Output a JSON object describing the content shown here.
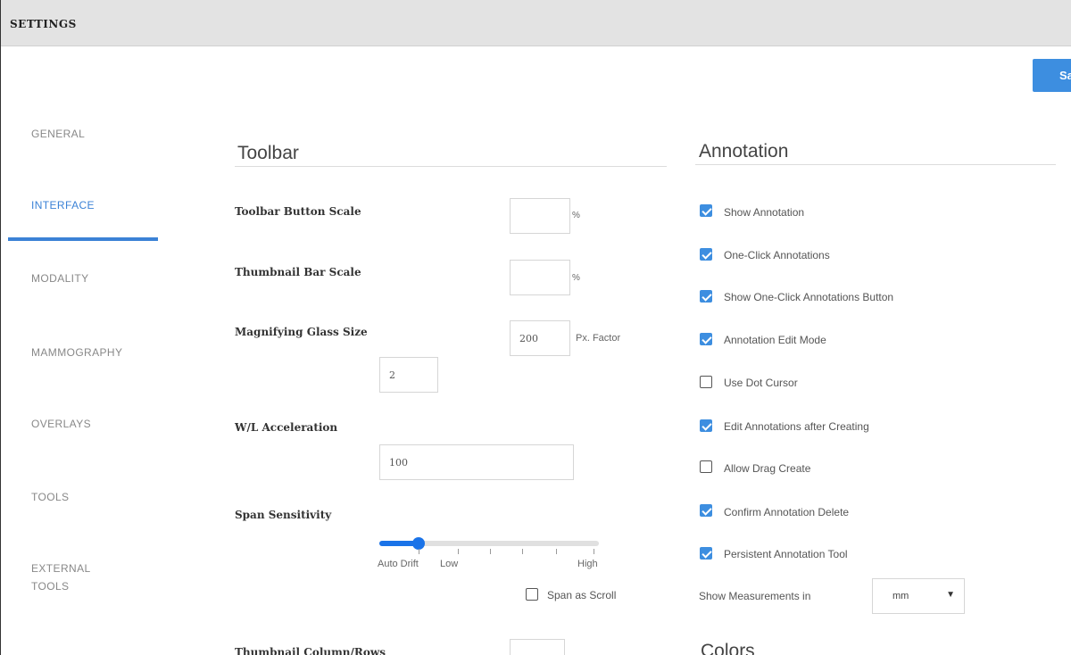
{
  "window": {
    "title": "SETTINGS"
  },
  "toolbar": {
    "save_label": "Sa"
  },
  "sidebar": {
    "items": [
      {
        "label": "GENERAL"
      },
      {
        "label": "INTERFACE",
        "active": true
      },
      {
        "label": "MODALITY"
      },
      {
        "label": "MAMMOGRAPHY"
      },
      {
        "label": "OVERLAYS"
      },
      {
        "label": "TOOLS"
      },
      {
        "label": "EXTERNAL"
      },
      {
        "label": "TOOLS"
      }
    ]
  },
  "toolbar_section": {
    "title": "Toolbar",
    "button_scale": {
      "label": "Toolbar Button Scale",
      "value": "",
      "unit": "%"
    },
    "thumbnail_scale": {
      "label": "Thumbnail Bar Scale",
      "value": "",
      "unit": "%"
    },
    "magnifier": {
      "label": "Magnifying Glass Size",
      "value": "200",
      "unit_label": "Px. Factor",
      "factor": "2"
    },
    "wl_acceleration": {
      "label": "W/L Acceleration",
      "value": "100"
    },
    "span_sensitivity": {
      "label": "Span Sensitivity",
      "level": 0.18,
      "captions": {
        "auto": "Auto Drift",
        "low": "Low",
        "high": "High"
      }
    },
    "span_as_scroll": {
      "label": "Span as Scroll",
      "checked": false
    },
    "thumbnail_rows": {
      "label": "Thumbnail Column/Rows"
    }
  },
  "annotation_section": {
    "title": "Annotation",
    "options": [
      {
        "label": "Show Annotation",
        "checked": true
      },
      {
        "label": "One-Click Annotations",
        "checked": true
      },
      {
        "label": "Show One-Click Annotations Button",
        "checked": true
      },
      {
        "label": "Annotation Edit Mode",
        "checked": true
      },
      {
        "label": "Use Dot Cursor",
        "checked": false
      },
      {
        "label": "Edit Annotations after Creating",
        "checked": true
      },
      {
        "label": "Allow Drag Create",
        "checked": false
      },
      {
        "label": "Confirm Annotation Delete",
        "checked": true
      },
      {
        "label": "Persistent Annotation Tool",
        "checked": true
      }
    ],
    "measurements": {
      "label": "Show Measurements in",
      "selected": "mm"
    }
  },
  "colors_section": {
    "title": "Colors"
  },
  "colors": {
    "accent": "#3d8ee0",
    "nav_active": "#3b82d6",
    "title_bar": "#e3e3e3"
  }
}
